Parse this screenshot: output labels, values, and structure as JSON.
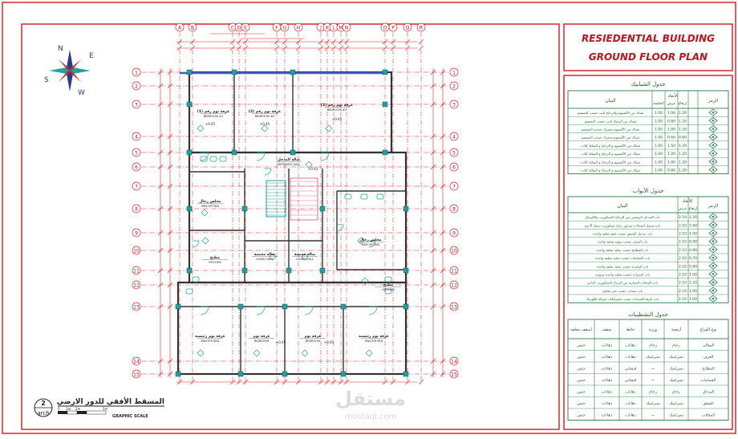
{
  "title_block": {
    "line1": "RESIEDENTIAL BUILDING",
    "line2": "GROUND FLOOR PLAN"
  },
  "windows_table": {
    "title": "جدول الشبابيك",
    "headers": {
      "symbol": "الرمز",
      "dims": "الأبعاد",
      "width": "عرض",
      "height": "ارتفاع",
      "sill": "الجلسة",
      "desc": "البيان"
    },
    "rows": [
      {
        "sym": "W1",
        "w": "1.00",
        "h": "1.20",
        "s": "1.00",
        "desc": "شباك من الألمنيوم والزجاج ثابت حسب التصميم"
      },
      {
        "sym": "W2",
        "w": "0.80",
        "h": "1.20",
        "s": "1.00",
        "desc": "شباك من الزجاج ثابت حسب التصميم"
      },
      {
        "sym": "W3",
        "w": "1.00",
        "h": "1.20",
        "s": "1.00",
        "desc": "شباك من الألمنيوم متحرك حسب التصميم"
      },
      {
        "sym": "W4",
        "w": "0.60",
        "h": "0.60",
        "s": "1.00",
        "desc": "شباك من الألمنيوم متحرك حسب التصميم"
      },
      {
        "sym": "W5",
        "w": "1.50",
        "h": "1.20",
        "s": "1.00",
        "desc": "شباك من الألمنيوم و الزجاج و السلك كلاب"
      },
      {
        "sym": "W6",
        "w": "1.20",
        "h": "1.20",
        "s": "1.00",
        "desc": "شباك من الألمنيوم و الزجاج و السلك كلاب"
      },
      {
        "sym": "W7",
        "w": "1.00",
        "h": "1.20",
        "s": "1.00",
        "desc": "شباك من الألمنيوم و الزجاج و السلك كلاب"
      },
      {
        "sym": "W8",
        "w": "0.80",
        "h": "1.20",
        "s": "1.00",
        "desc": "شباك من الألمنيوم و الزجاج و السلك كلاب"
      }
    ]
  },
  "doors_table": {
    "title": "جدول الأبواب",
    "headers": {
      "symbol": "الرمز",
      "dims": "الأبعاد",
      "width": "عرض",
      "height": "ارتفاع",
      "desc": "البيان"
    },
    "rows": [
      {
        "sym": "D1",
        "w": "2.10",
        "h": "1.20",
        "desc": "باب المدخل الرئيسي من الزجاج السيكوريت والكريتال"
      },
      {
        "sym": "D2",
        "w": "2.10",
        "h": "1.60",
        "desc": "باب مدخل المحلات منزلق زجاج سيكوريت سمك 8 مم"
      },
      {
        "sym": "D3",
        "w": "2.10",
        "h": "1.00",
        "desc": "باب مدخل الشقق خشب عقم ضلفة واحدة"
      },
      {
        "sym": "D4",
        "w": "2.10",
        "h": "0.90",
        "desc": "باب الغرف خشب سويد ضلفة واحدة"
      },
      {
        "sym": "D5",
        "w": "2.10",
        "h": "0.80",
        "desc": "باب المطابخ خشب تجليد ضلفة واحدة"
      },
      {
        "sym": "D6",
        "w": "2.10",
        "h": "0.70",
        "desc": "باب الحمامات خشب تجليد ضلفة واحدة"
      },
      {
        "sym": "D7",
        "w": "2.10",
        "h": "0.80",
        "desc": "باب المخزن خشب تجليد ضلفة واحدة"
      },
      {
        "sym": "D8",
        "w": "2.10",
        "h": "1.00",
        "desc": "باب السرات خشب ضلفة واحدة مروحة"
      },
      {
        "sym": "D9",
        "w": "2.10",
        "h": "1.20",
        "desc": "باب المحلات التجارية من الزجاج السيكوريت الذاتي"
      },
      {
        "sym": "D10",
        "w": "2.10",
        "h": "1.00",
        "desc": "باب سحاب خشب حتر مفاتيل"
      },
      {
        "sym": "D11",
        "w": "2.10",
        "h": "1.00",
        "desc": "باب غرفة الخدمات حسب اشتراطات شركة الكهرباء"
      }
    ]
  },
  "finishes_table": {
    "title": "جدول التشطيبات",
    "headers": [
      "نوع الفراغ",
      "أرضية",
      "وزرة",
      "حائط",
      "سقف",
      "أسقف معلقة"
    ],
    "rows": [
      [
        "المعالى",
        "رخام",
        "رخام",
        "دهانات",
        "دهانات",
        "جبس"
      ],
      [
        "الغرف",
        "سيراميك",
        "سيراميك",
        "دهانات",
        "دهانات",
        "جبس"
      ],
      [
        "المطابخ",
        "سيراميك",
        "—",
        "قيشاني",
        "دهانات",
        "جبس"
      ],
      [
        "الحمامات",
        "سيراميك",
        "—",
        "قيشاني",
        "دهانات",
        "جبس"
      ],
      [
        "المدخل",
        "رخام",
        "رخام",
        "دهانات",
        "دهانات",
        "جبس"
      ],
      [
        "الشقق",
        "سيراميك",
        "سيراميك",
        "دهانات",
        "دهانات",
        "جبس"
      ],
      [
        "المحلات",
        "سيراميك",
        "—",
        "دهانات",
        "دهانات",
        "جبس"
      ]
    ]
  },
  "plan": {
    "col_labels": [
      "A",
      "B",
      "C",
      "D",
      "E",
      "F",
      "G",
      "H",
      "J",
      "K",
      "L",
      "M",
      "N",
      "O",
      "P",
      "Q",
      "R"
    ],
    "row_labels": [
      "1",
      "2",
      "3",
      "4",
      "5",
      "6",
      "7",
      "8",
      "9",
      "10",
      "11",
      "12",
      "13",
      "14",
      "15"
    ],
    "caption": "المسقط الأفقي للدور الارضي",
    "scale_label": "GRAPHIC SCALE",
    "detail_num": "2",
    "detail_name": "arch",
    "scale_marks": [
      "0",
      "1m",
      "2m",
      "5m"
    ],
    "rooms": [
      {
        "name": "غرفة نوم رقم (1)",
        "en": "BEDROOM #1"
      },
      {
        "name": "غرفة نوم رقم (2)",
        "en": "BEDROOM #2"
      },
      {
        "name": "غرفة نوم رقم (3)",
        "en": "BEDROOM #3"
      },
      {
        "name": "مجلس رجال",
        "en": "MEN SITTING"
      },
      {
        "name": "صالة معيشة",
        "en": "LIVING HALL"
      },
      {
        "name": "صالة معيشة",
        "en": "LIVING HALL"
      },
      {
        "name": "مجلس رجال",
        "en": "MEN SITTING"
      },
      {
        "name": "مطبخ",
        "en": "KITCHEN"
      },
      {
        "name": "مطبخ",
        "en": "KITCHEN"
      },
      {
        "name": "غرفة نوم رئيسية",
        "en": "MASTER BED"
      },
      {
        "name": "غرفة نوم",
        "en": "BEDROOM"
      },
      {
        "name": "غرفة نوم",
        "en": "BEDROOM"
      },
      {
        "name": "غرفة نوم رئيسية",
        "en": "MASTER BED"
      },
      {
        "name": "صالة المدخل",
        "en": "ENTRANCE HALL"
      }
    ],
    "levels": [
      "+0.45",
      "+0.45",
      "+0.45",
      "+0.45",
      "+0.45",
      "+0.45"
    ]
  },
  "compass": {
    "labels": [
      "N",
      "E",
      "S",
      "W"
    ]
  },
  "watermark": "مستقل",
  "watermark_sub": "mostaql.com",
  "colors": {
    "frame": "#d42a2a",
    "title_text": "#c2121c",
    "grid": "#e22424",
    "wall": "#333333",
    "table_line": "#2a7a40",
    "table_text": "#1f5c2e",
    "teal": "#1fa1a1",
    "blue": "#3b5fcf"
  }
}
